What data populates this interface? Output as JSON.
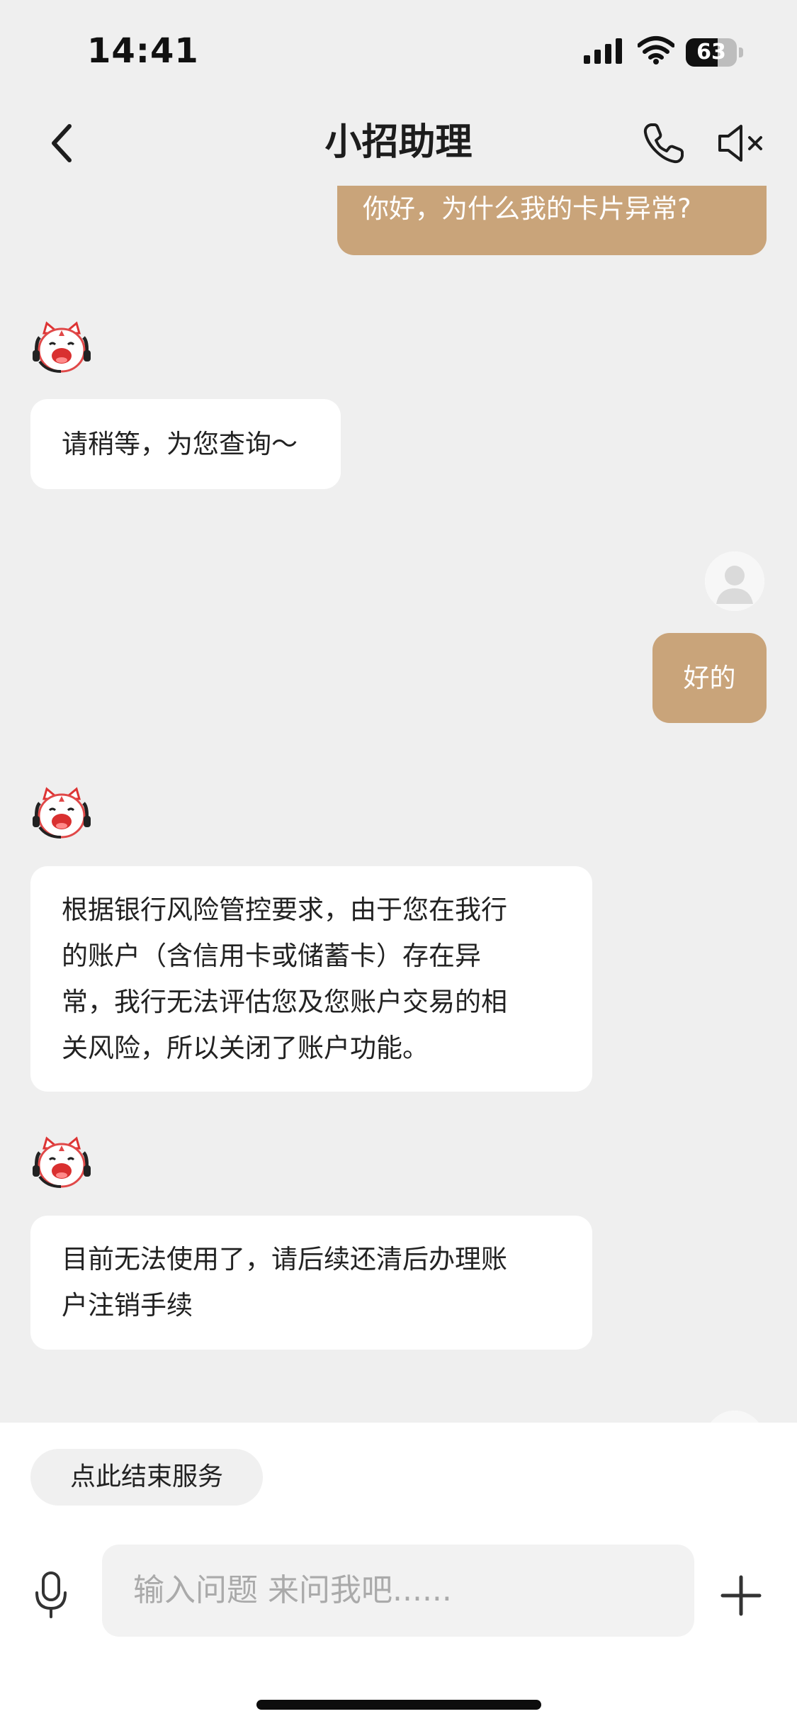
{
  "status_bar": {
    "time": "14:41",
    "battery": "63",
    "battery_level": 0.63
  },
  "header": {
    "title": "小招助理",
    "icons": [
      "back-icon",
      "phone-icon",
      "mute-icon"
    ]
  },
  "messages": [
    {
      "sender": "user",
      "text": "你好，为什么我的卡片异常?"
    },
    {
      "sender": "bot",
      "lines": [
        "请稍等，为您查询～"
      ]
    },
    {
      "sender": "user",
      "text": "好的"
    },
    {
      "sender": "bot",
      "lines": [
        "根据银行风险管控要求，由于您在我行",
        "的账户（含信用卡或储蓄卡）存在异",
        "常，我行无法评估您及您账户交易的相",
        "关风险，所以关闭了账户功能。"
      ]
    },
    {
      "sender": "bot",
      "lines": [
        "目前无法使用了，请后续还清后办理账",
        "户注销手续"
      ]
    }
  ],
  "bottom": {
    "end_service_label": "点此结束服务",
    "input_placeholder": "输入问题 来问我吧......"
  },
  "colors": {
    "background": "#efefef",
    "user_bubble": "#c9a47a",
    "bot_bubble": "#ffffff"
  }
}
